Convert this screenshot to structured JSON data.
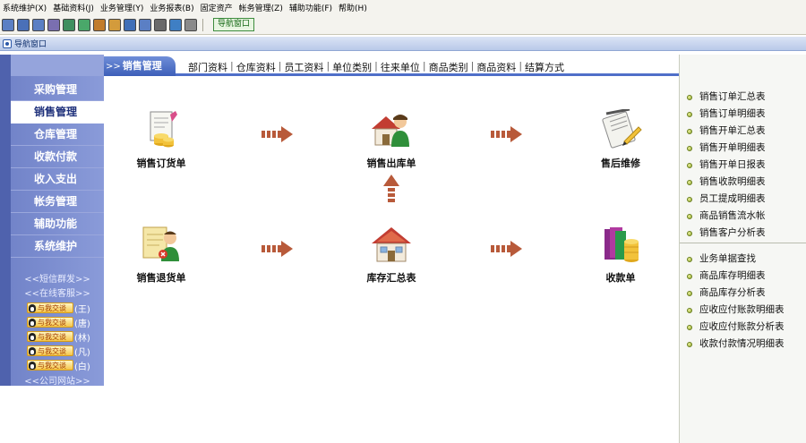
{
  "menubar": {
    "items": [
      "系统维护(X)",
      "基础资料(J)",
      "业务管理(Y)",
      "业务报表(B)",
      "固定资产",
      "帐务管理(Z)",
      "辅助功能(F)",
      "帮助(H)"
    ]
  },
  "toolbar": {
    "button_colors": [
      "#5b7fc4",
      "#4a70b8",
      "#5b7fc4",
      "#7a6fb0",
      "#3f8f5f",
      "#4aa86a",
      "#c27c2c",
      "#d39b3c",
      "#3f6fb8",
      "#5b7fc4",
      "#6a6a6a",
      "#3f7fc4",
      "#8a8a8a"
    ],
    "nav_button": "导航窗口"
  },
  "window": {
    "title": "导航窗口"
  },
  "sidebar": {
    "items": [
      {
        "label": "采购管理",
        "active": false
      },
      {
        "label": "销售管理",
        "active": true
      },
      {
        "label": "仓库管理",
        "active": false
      },
      {
        "label": "收款付款",
        "active": false
      },
      {
        "label": "收入支出",
        "active": false
      },
      {
        "label": "帐务管理",
        "active": false
      },
      {
        "label": "辅助功能",
        "active": false
      },
      {
        "label": "系统维护",
        "active": false
      }
    ],
    "sms": "<<短信群发>>",
    "support": "<<在线客服>>",
    "qq_badge": "与我交谈",
    "qq_contacts": [
      "(王)",
      "(唐)",
      "(林)",
      "(凡)",
      "(白)"
    ],
    "website": "<<公司网站>>"
  },
  "topnav": {
    "prefix": ">>",
    "current": "销售管理",
    "links": [
      "部门资料",
      "仓库资料",
      "员工资料",
      "单位类别",
      "往来单位",
      "商品类别",
      "商品资料",
      "结算方式"
    ],
    "separator": "|"
  },
  "flow": {
    "nodes": [
      {
        "label": "销售订货单",
        "icon": "sales-order-icon"
      },
      {
        "label": "销售出库单",
        "icon": "sales-outbound-icon"
      },
      {
        "label": "售后维修",
        "icon": "after-sales-icon"
      },
      {
        "label": "销售退货单",
        "icon": "sales-return-icon"
      },
      {
        "label": "库存汇总表",
        "icon": "inventory-summary-icon"
      },
      {
        "label": "收款单",
        "icon": "receipt-icon"
      }
    ],
    "arrow_color": "#b85a3a"
  },
  "reports": {
    "group1": [
      "销售订单汇总表",
      "销售订单明细表",
      "销售开单汇总表",
      "销售开单明细表",
      "销售开单日报表",
      "销售收款明细表",
      "员工提成明细表",
      "商品销售流水帐",
      "销售客户分析表"
    ],
    "group2": [
      "业务单据查找",
      "商品库存明细表",
      "商品库存分析表",
      "应收应付账款明细表",
      "应收应付账款分析表",
      "收款付款情况明细表"
    ]
  }
}
